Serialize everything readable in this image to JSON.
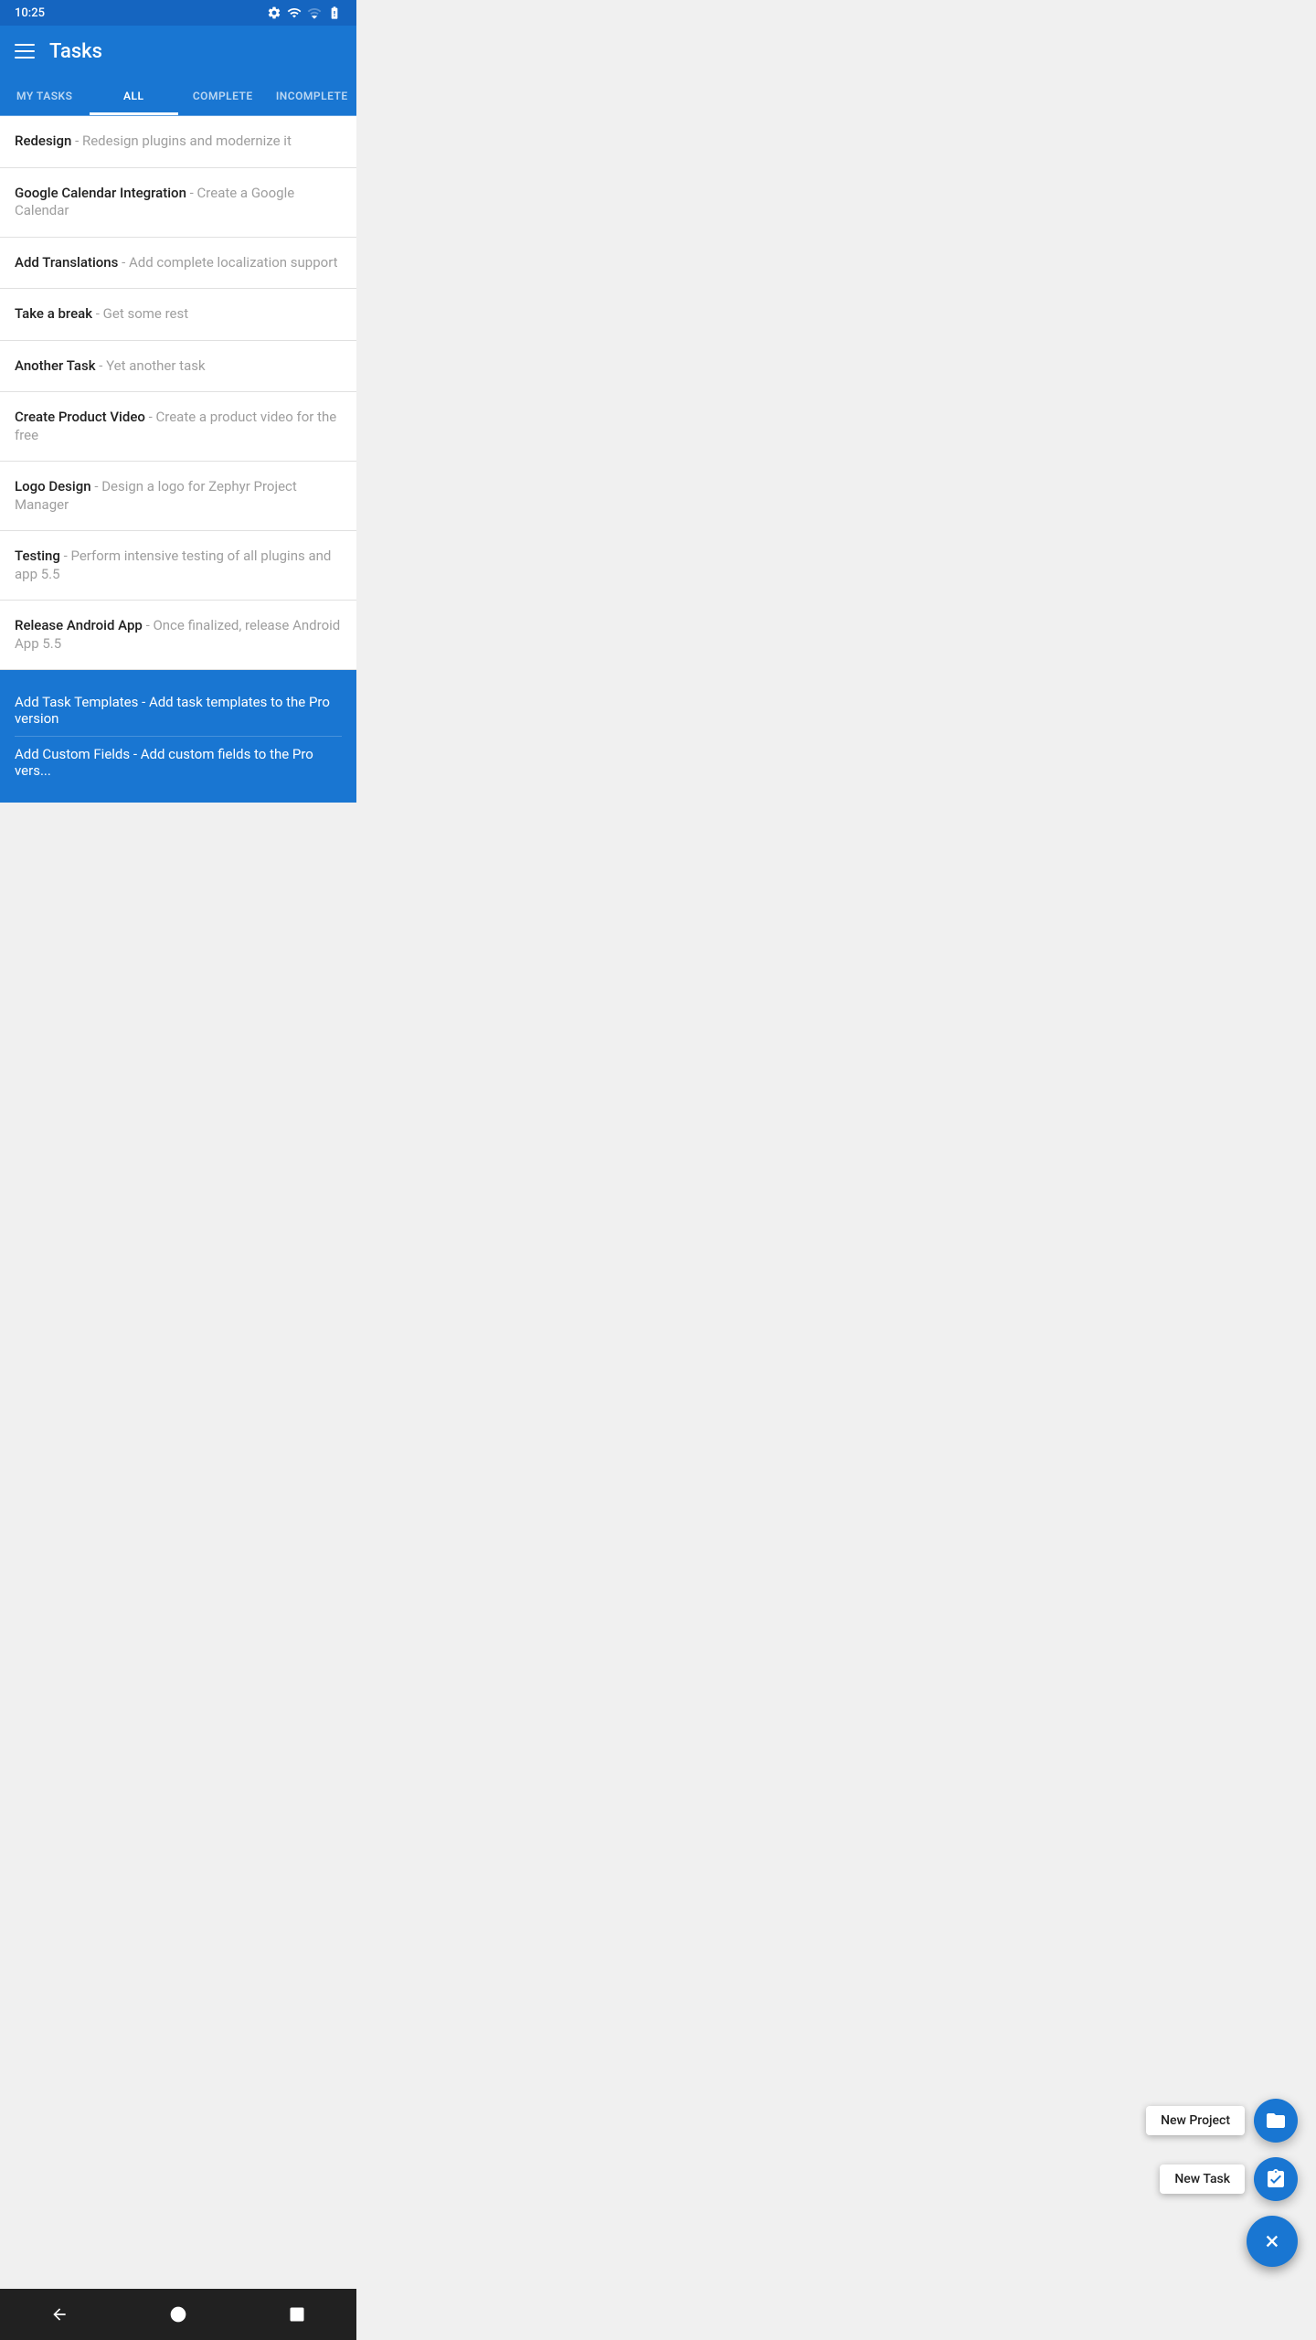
{
  "status": {
    "time": "10:25",
    "settings_icon": "⚙"
  },
  "app_bar": {
    "title": "Tasks",
    "menu_icon": "hamburger"
  },
  "tabs": [
    {
      "id": "my-tasks",
      "label": "MY TASKS",
      "active": false
    },
    {
      "id": "all",
      "label": "ALL",
      "active": true
    },
    {
      "id": "complete",
      "label": "COMPLETE",
      "active": false
    },
    {
      "id": "incomplete",
      "label": "INCOMPLETE",
      "active": false
    }
  ],
  "tasks": [
    {
      "name": "Redesign",
      "desc": "Redesign plugins and modernize it"
    },
    {
      "name": "Google Calendar Integration",
      "desc": "Create a Google Calendar"
    },
    {
      "name": "Add Translations",
      "desc": "Add complete localization support"
    },
    {
      "name": "Take a break",
      "desc": "Get some rest"
    },
    {
      "name": "Another Task",
      "desc": "Yet another task"
    },
    {
      "name": "Create Product Video",
      "desc": "Create a product video for the free"
    },
    {
      "name": "Logo Design",
      "desc": "Design a logo for Zephyr Project Manager"
    },
    {
      "name": "Testing",
      "desc": "Perform intensive testing of all plugins and app 5.5"
    },
    {
      "name": "Release Android App",
      "desc": "Once finalized, release Android App 5.5"
    }
  ],
  "blue_tasks": [
    {
      "text": "Add Task Templates - Add task templates to the Pro version"
    },
    {
      "text": "Add Custom Fields - Add custom fields to the Pro vers..."
    }
  ],
  "fab": {
    "new_project_label": "New Project",
    "new_task_label": "New Task",
    "close_label": "×"
  }
}
